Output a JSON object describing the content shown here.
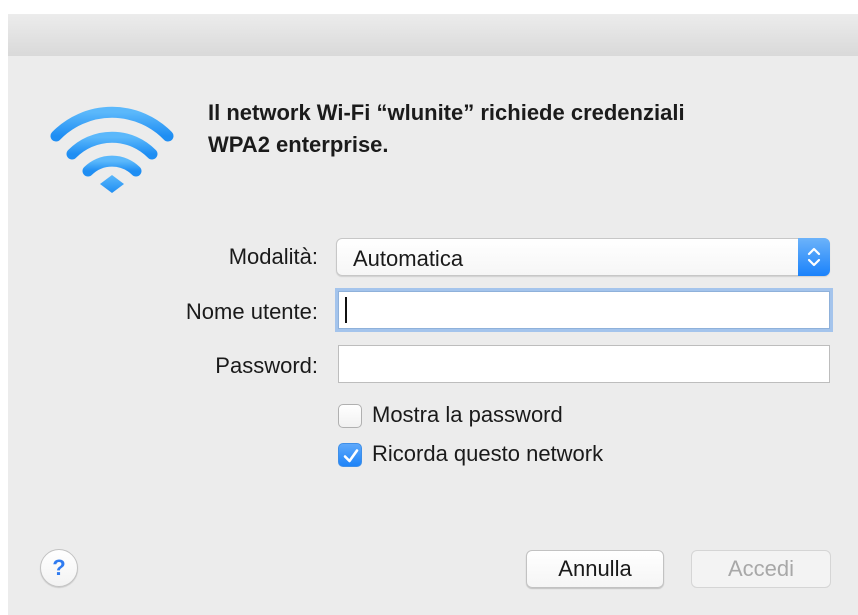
{
  "dialog": {
    "headline_line1": "Il network Wi-Fi “wlunite” richiede credenziali",
    "headline_line2": "WPA2 enterprise."
  },
  "form": {
    "mode_label": "Modalità:",
    "mode_value": "Automatica",
    "username_label": "Nome utente:",
    "username_value": "",
    "password_label": "Password:",
    "password_value": ""
  },
  "options": {
    "show_password_label": "Mostra la password",
    "show_password_checked": false,
    "remember_network_label": "Ricorda questo network",
    "remember_network_checked": true
  },
  "buttons": {
    "help_label": "?",
    "cancel_label": "Annulla",
    "join_label": "Accedi",
    "join_enabled": false
  },
  "colors": {
    "accent": "#1a82fb",
    "wifi_icon": "#3aa3f6",
    "focus_ring": "#a4c4ec"
  },
  "icons": {
    "dialog_icon": "wifi-icon",
    "mode_select": "up-down-arrows-icon",
    "checkmark": "checkmark-icon"
  }
}
